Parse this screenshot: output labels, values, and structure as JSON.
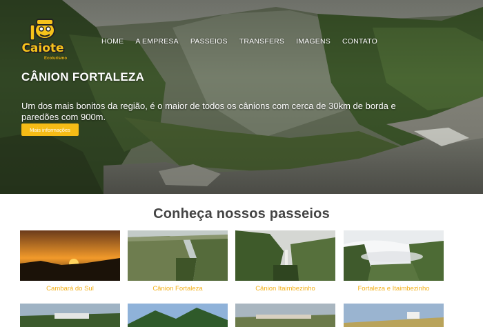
{
  "logo": {
    "text": "Caiote",
    "subtitle": "Ecoturismo"
  },
  "nav": [
    "HOME",
    "A EMPRESA",
    "PASSEIOS",
    "TRANSFERS",
    "IMAGENS",
    "CONTATO"
  ],
  "hero": {
    "title": "CÂNION FORTALEZA",
    "description": "Um dos mais bonitos da região, é o maior de todos os cânions com cerca de 30km de borda e paredões com 900m.",
    "button": "Mais informações"
  },
  "section": {
    "title": "Conheça nossos passeios"
  },
  "tours": [
    {
      "label": "Cambará do Sul"
    },
    {
      "label": "Cânion Fortaleza"
    },
    {
      "label": "Cânion Itaimbezinho"
    },
    {
      "label": "Fortaleza e Itaimbezinho"
    }
  ],
  "colors": {
    "accent": "#f6bc16",
    "caption": "#f3b018",
    "heading": "#444444"
  }
}
